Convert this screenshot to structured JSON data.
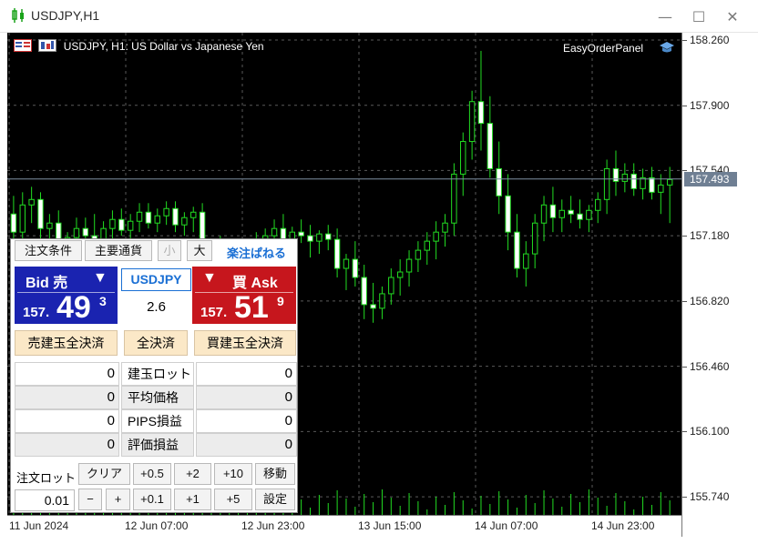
{
  "window": {
    "title": "USDJPY,H1",
    "controls": {
      "minimize": "—",
      "maximize": "☐",
      "close": "✕"
    }
  },
  "chart": {
    "header": "USDJPY, H1:  US Dollar vs Japanese Yen",
    "ea_name": "EasyOrderPanel",
    "background": "#000000",
    "candle_color": "#22dd22",
    "bull_fill": "#ffffff",
    "current_price": "157.493",
    "price_labels": [
      "158.260",
      "157.900",
      "157.540",
      "157.180",
      "156.820",
      "156.460",
      "156.100",
      "155.740"
    ],
    "time_labels": [
      "11 Jun 2024",
      "12 Jun 07:00",
      "12 Jun 23:00",
      "13 Jun 15:00",
      "14 Jun 07:00",
      "14 Jun 23:00"
    ]
  },
  "chart_data": {
    "type": "candlestick",
    "symbol": "USDJPY",
    "timeframe": "H1",
    "ylim": [
      155.64,
      158.3
    ],
    "last_price": 157.493,
    "candles_ohlc": [
      [
        157.3,
        157.4,
        157.08,
        157.2
      ],
      [
        157.2,
        157.42,
        157.05,
        157.35
      ],
      [
        157.35,
        157.45,
        157.25,
        157.38
      ],
      [
        157.38,
        157.42,
        157.15,
        157.22
      ],
      [
        157.22,
        157.3,
        157.12,
        157.25
      ],
      [
        157.25,
        157.32,
        157.1,
        157.14
      ],
      [
        157.14,
        157.2,
        157.05,
        157.17
      ],
      [
        157.17,
        157.28,
        157.1,
        157.22
      ],
      [
        157.22,
        157.28,
        157.12,
        157.18
      ],
      [
        157.18,
        157.3,
        157.12,
        157.16
      ],
      [
        157.16,
        157.26,
        157.1,
        157.22
      ],
      [
        157.22,
        157.32,
        157.15,
        157.27
      ],
      [
        157.27,
        157.33,
        157.18,
        157.21
      ],
      [
        157.21,
        157.3,
        157.15,
        157.26
      ],
      [
        157.26,
        157.36,
        157.2,
        157.31
      ],
      [
        157.31,
        157.36,
        157.22,
        157.25
      ],
      [
        157.25,
        157.33,
        157.2,
        157.29
      ],
      [
        157.29,
        157.37,
        157.24,
        157.33
      ],
      [
        157.33,
        157.37,
        157.2,
        157.24
      ],
      [
        157.24,
        157.31,
        157.18,
        157.28
      ],
      [
        157.28,
        157.34,
        157.2,
        157.31
      ],
      [
        157.31,
        157.36,
        157.0,
        157.05
      ],
      [
        157.05,
        157.12,
        156.95,
        157.1
      ],
      [
        157.1,
        157.18,
        157.0,
        157.08
      ],
      [
        157.08,
        157.15,
        156.98,
        157.03
      ],
      [
        157.03,
        157.1,
        156.95,
        157.07
      ],
      [
        157.07,
        157.15,
        157.0,
        157.12
      ],
      [
        157.12,
        157.2,
        157.05,
        157.15
      ],
      [
        157.15,
        157.22,
        157.08,
        157.18
      ],
      [
        157.18,
        157.27,
        157.12,
        157.22
      ],
      [
        157.22,
        157.3,
        157.13,
        157.16
      ],
      [
        157.16,
        157.23,
        157.1,
        157.2
      ],
      [
        157.2,
        157.27,
        157.14,
        157.18
      ],
      [
        157.18,
        157.24,
        157.06,
        157.15
      ],
      [
        157.15,
        157.21,
        157.08,
        157.19
      ],
      [
        157.19,
        157.24,
        157.1,
        157.16
      ],
      [
        157.16,
        157.22,
        156.95,
        157.0
      ],
      [
        157.0,
        157.08,
        156.88,
        157.05
      ],
      [
        157.05,
        157.15,
        156.9,
        156.95
      ],
      [
        156.95,
        157.02,
        156.72,
        156.8
      ],
      [
        156.8,
        156.92,
        156.7,
        156.78
      ],
      [
        156.78,
        156.9,
        156.72,
        156.86
      ],
      [
        156.86,
        157.0,
        156.8,
        156.95
      ],
      [
        156.95,
        157.05,
        156.85,
        156.98
      ],
      [
        156.98,
        157.1,
        156.9,
        157.05
      ],
      [
        157.05,
        157.15,
        156.98,
        157.1
      ],
      [
        157.1,
        157.2,
        157.02,
        157.15
      ],
      [
        157.15,
        157.26,
        157.05,
        157.2
      ],
      [
        157.2,
        157.3,
        157.12,
        157.25
      ],
      [
        157.25,
        157.58,
        157.18,
        157.52
      ],
      [
        157.52,
        157.75,
        157.4,
        157.7
      ],
      [
        157.7,
        157.98,
        157.6,
        157.92
      ],
      [
        157.92,
        158.2,
        157.65,
        157.8
      ],
      [
        157.8,
        157.95,
        157.5,
        157.55
      ],
      [
        157.55,
        157.7,
        157.3,
        157.4
      ],
      [
        157.4,
        157.52,
        157.1,
        157.2
      ],
      [
        157.2,
        157.3,
        156.95,
        157.0
      ],
      [
        157.0,
        157.15,
        156.9,
        157.08
      ],
      [
        157.08,
        157.3,
        157.0,
        157.25
      ],
      [
        157.25,
        157.4,
        157.15,
        157.35
      ],
      [
        157.35,
        157.45,
        157.2,
        157.28
      ],
      [
        157.28,
        157.38,
        157.2,
        157.32
      ],
      [
        157.32,
        157.4,
        157.25,
        157.3
      ],
      [
        157.3,
        157.38,
        157.22,
        157.27
      ],
      [
        157.27,
        157.35,
        157.2,
        157.32
      ],
      [
        157.32,
        157.42,
        157.25,
        157.38
      ],
      [
        157.38,
        157.6,
        157.3,
        157.55
      ],
      [
        157.55,
        157.65,
        157.4,
        157.48
      ],
      [
        157.48,
        157.58,
        157.42,
        157.52
      ],
      [
        157.52,
        157.58,
        157.4,
        157.44
      ],
      [
        157.44,
        157.55,
        157.38,
        157.5
      ],
      [
        157.5,
        157.56,
        157.38,
        157.42
      ],
      [
        157.42,
        157.52,
        157.3,
        157.46
      ],
      [
        157.46,
        157.56,
        157.25,
        157.49
      ]
    ]
  },
  "panel": {
    "tabs": [
      "注文条件",
      "主要通貨",
      "小",
      "大"
    ],
    "brand": "楽注ぱねる",
    "bid": {
      "label": "Bid 売",
      "arrow": "▼",
      "prefix": "157.",
      "big": "49",
      "sup": "3"
    },
    "ask": {
      "label": "買 Ask",
      "arrow": "▼",
      "prefix": "157.",
      "big": "51",
      "sup": "9"
    },
    "symbol": "USDJPY",
    "spread": "2.6",
    "close_buttons": [
      "売建玉全決済",
      "全決済",
      "買建玉全決済"
    ],
    "rows": [
      {
        "left": "0",
        "label": "建玉ロット",
        "right": "0"
      },
      {
        "left": "0",
        "label": "平均価格",
        "right": "0"
      },
      {
        "left": "0",
        "label": "PIPS損益",
        "right": "0"
      },
      {
        "left": "0",
        "label": "評価損益",
        "right": "0"
      }
    ],
    "lot_label": "注文ロット",
    "lot_value": "0.01",
    "row1_buttons": [
      "クリア",
      "+0.5",
      "+2",
      "+10",
      "移動"
    ],
    "row2_buttons": [
      "−",
      "+",
      "+0.1",
      "+1",
      "+5",
      "設定"
    ]
  }
}
